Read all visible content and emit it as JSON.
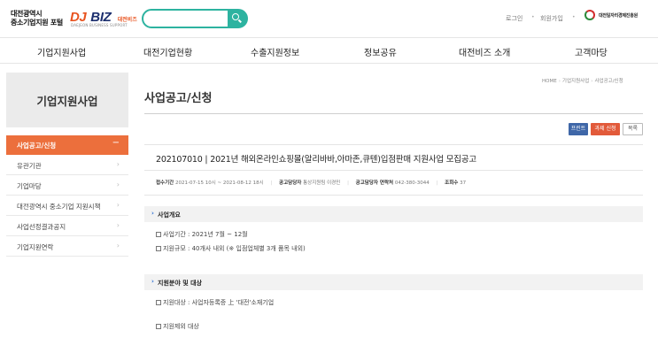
{
  "header": {
    "logo_line1": "대전광역시",
    "logo_line2": "중소기업지원 포털",
    "brand_dj": "DJ",
    "brand_biz": "BIZ",
    "brand_kr": "대전비즈",
    "brand_sub": "DAEJEON BUSINESS SUPPORT",
    "search_placeholder": "",
    "util_login": "로그인",
    "util_join": "회원가입",
    "org_name": "대전일자리경제진흥원"
  },
  "gnb": {
    "items": [
      {
        "label": "기업지원사업"
      },
      {
        "label": "대전기업현황"
      },
      {
        "label": "수출지원정보"
      },
      {
        "label": "정보공유"
      },
      {
        "label": "대전비즈 소개"
      },
      {
        "label": "고객마당"
      }
    ]
  },
  "sidebar": {
    "title": "기업지원사업",
    "items": [
      {
        "label": "사업공고/신청",
        "active": true,
        "chevron": "−"
      },
      {
        "label": "유관기관",
        "chevron": "›"
      },
      {
        "label": "기업마당",
        "chevron": "›"
      },
      {
        "label": "대전광역시 중소기업 지원시책",
        "chevron": "›"
      },
      {
        "label": "사업선정결과공지",
        "chevron": "›"
      },
      {
        "label": "기업지원연락",
        "chevron": "›"
      }
    ]
  },
  "breadcrumb": {
    "home": "HOME",
    "level1": "기업지원사업",
    "level2": "사업공고/신청"
  },
  "page": {
    "title": "사업공고/신청",
    "btn_print": "프린트",
    "btn_apply": "과제 신청",
    "btn_list": "목록"
  },
  "post": {
    "title": "202107010 | 2021년 해외온라인쇼핑몰(알리바바,아마존,큐텐)입점판매 지원사업 모집공고",
    "period_label": "접수기간",
    "period_value": "2021-07-15 10시 ~ 2021-08-12 18시",
    "manager_label": "공고담당자",
    "manager_value": "통상지원팀 이경민",
    "contact_label": "공고담당자 연락처",
    "contact_value": "042-380-3044",
    "views_label": "조회수",
    "views_value": "37"
  },
  "sections": [
    {
      "title": "사업개요",
      "bullets": [
        "사업기간 : 2021년 7월 ~ 12월",
        "지원규모 : 40개사 내외 (※ 입점업체별 3개 품목 내외)"
      ]
    },
    {
      "title": "지원분야 및 대상",
      "bullets": [
        "지원대상 : 사업자등록증 上 '대전'소재기업",
        "지원제외 대상"
      ]
    }
  ],
  "colors": {
    "accent_orange": "#ec6f3c",
    "accent_teal": "#2db3a0",
    "accent_blue": "#3f67a8",
    "accent_red": "#e25a3a"
  }
}
